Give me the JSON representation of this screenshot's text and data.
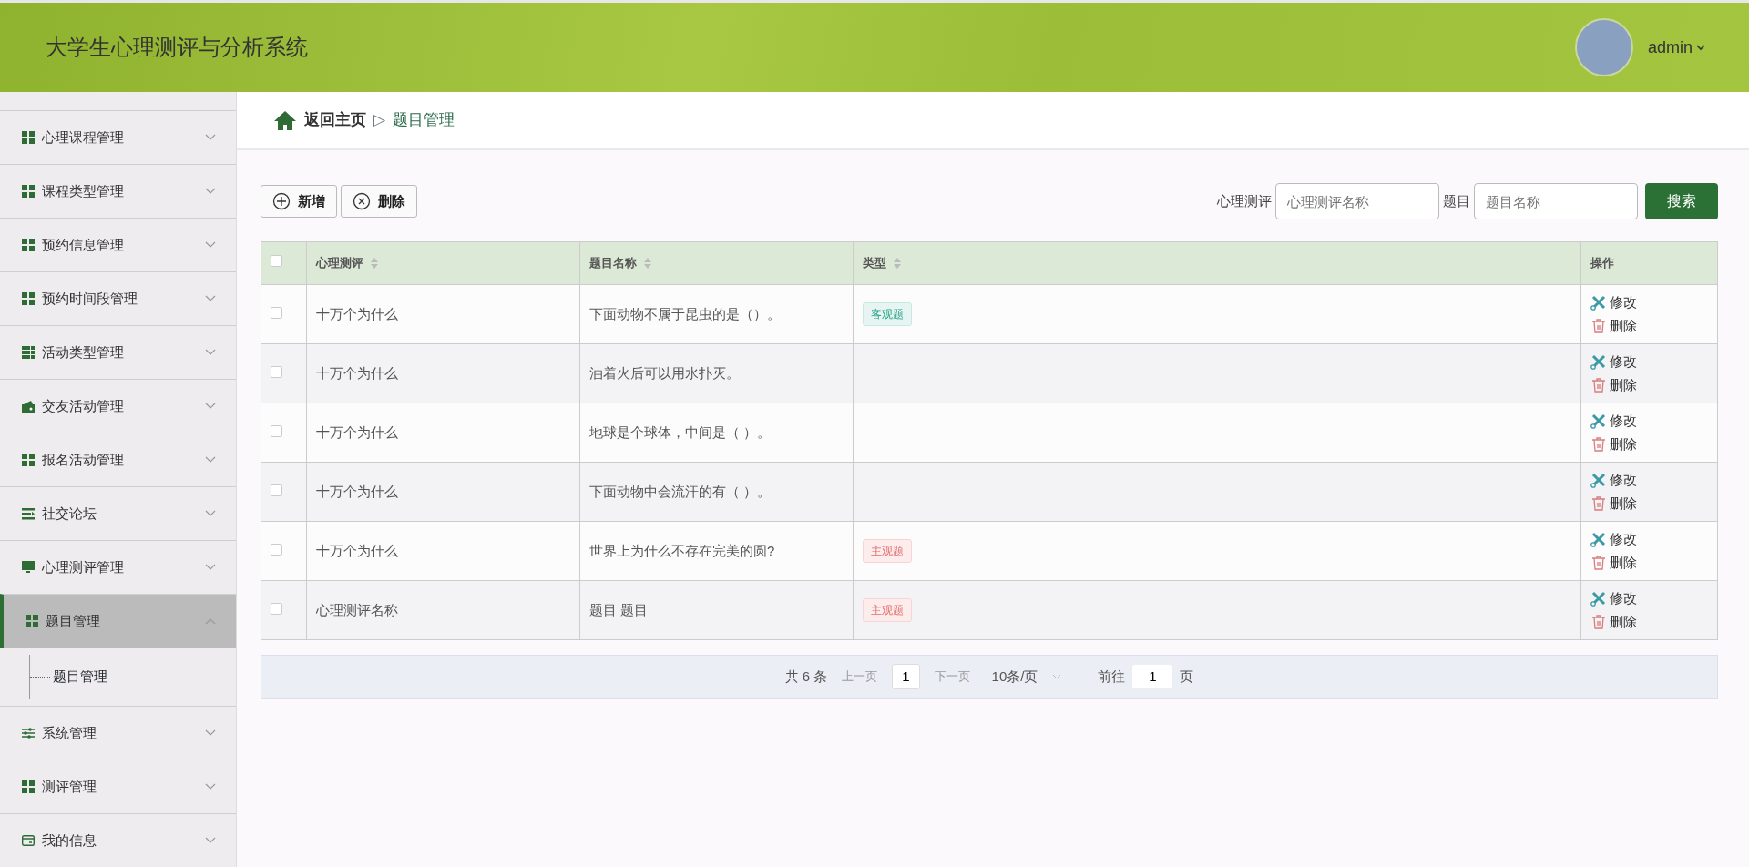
{
  "header": {
    "title": "大学生心理测评与分析系统",
    "user": "admin"
  },
  "sidebar": {
    "items": [
      {
        "label": "心理课程管理",
        "expanded": false,
        "selected": false
      },
      {
        "label": "课程类型管理",
        "expanded": false,
        "selected": false
      },
      {
        "label": "预约信息管理",
        "expanded": false,
        "selected": false
      },
      {
        "label": "预约时间段管理",
        "expanded": false,
        "selected": false
      },
      {
        "label": "活动类型管理",
        "expanded": false,
        "selected": false
      },
      {
        "label": "交友活动管理",
        "expanded": false,
        "selected": false
      },
      {
        "label": "报名活动管理",
        "expanded": false,
        "selected": false
      },
      {
        "label": "社交论坛",
        "expanded": false,
        "selected": false
      },
      {
        "label": "心理测评管理",
        "expanded": false,
        "selected": false
      },
      {
        "label": "题目管理",
        "expanded": true,
        "selected": true,
        "children": [
          {
            "label": "题目管理"
          }
        ]
      },
      {
        "label": "系统管理",
        "expanded": false,
        "selected": false
      },
      {
        "label": "测评管理",
        "expanded": false,
        "selected": false
      },
      {
        "label": "我的信息",
        "expanded": false,
        "selected": false
      }
    ]
  },
  "breadcrumb": {
    "home": "返回主页",
    "separator": "▷",
    "current": "题目管理"
  },
  "toolbar": {
    "buttons": [
      {
        "kind": "add",
        "label": "新增"
      },
      {
        "kind": "delete",
        "label": "删除"
      }
    ],
    "filters": [
      {
        "label": "心理测评",
        "placeholder": "心理测评名称"
      },
      {
        "label": "题目",
        "placeholder": "题目名称"
      }
    ],
    "search": "搜索"
  },
  "table": {
    "all_checked": false,
    "columns": [
      {
        "label": "心理测评",
        "sortable": true
      },
      {
        "label": "题目名称",
        "sortable": true
      },
      {
        "label": "类型",
        "sortable": true
      },
      {
        "label": "操作",
        "sortable": false
      }
    ],
    "rows": [
      {
        "checked": false,
        "exam": "十万个为什么",
        "question": "下面动物不属于昆虫的是（）。",
        "type": {
          "kind": "objective",
          "label": "客观题"
        },
        "actions": [
          "修改",
          "删除"
        ]
      },
      {
        "checked": false,
        "exam": "十万个为什么",
        "question": "油着火后可以用水扑灭。",
        "actions": [
          "修改",
          "删除"
        ]
      },
      {
        "checked": false,
        "exam": "十万个为什么",
        "question": "地球是个球体，中间是（ ）。",
        "actions": [
          "修改",
          "删除"
        ]
      },
      {
        "checked": false,
        "exam": "十万个为什么",
        "question": "下面动物中会流汗的有（ ）。",
        "actions": [
          "修改",
          "删除"
        ]
      },
      {
        "checked": false,
        "exam": "十万个为什么",
        "question": "世界上为什么不存在完美的圆?",
        "type": {
          "kind": "subjective",
          "label": "主观题"
        },
        "actions": [
          "修改",
          "删除"
        ]
      },
      {
        "checked": false,
        "exam": "心理测评名称",
        "question": "题目 题目",
        "type": {
          "kind": "subjective",
          "label": "主观题"
        },
        "actions": [
          "修改",
          "删除"
        ]
      }
    ]
  },
  "pagination": {
    "total": "共 6 条",
    "prev": "上一页",
    "page": "1",
    "next": "下一页",
    "size": "10条/页",
    "goto": "前往",
    "goto_value": "1",
    "goto_suffix": "页"
  }
}
